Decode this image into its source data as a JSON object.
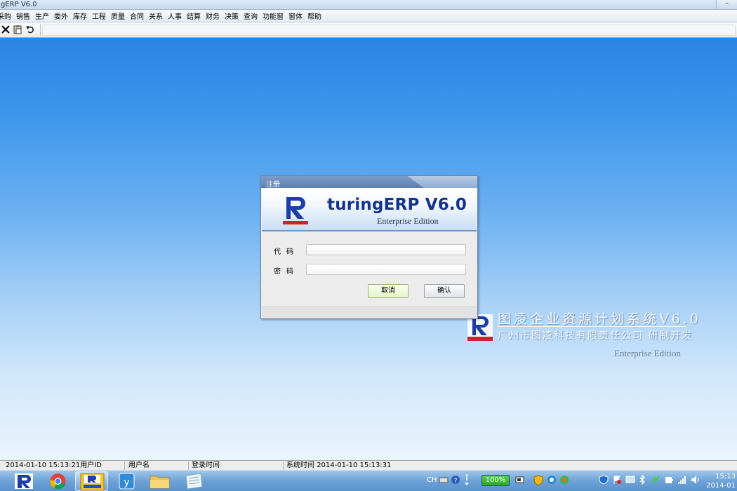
{
  "window": {
    "title": "gERP V6.0",
    "minimize_glyph": "–"
  },
  "menu": [
    "采购",
    "销售",
    "生产",
    "委外",
    "库存",
    "工程",
    "质量",
    "合同",
    "关系",
    "人事",
    "结算",
    "财务",
    "决策",
    "查询",
    "功能窗",
    "窗体",
    "帮助"
  ],
  "toolbar": {
    "icons": [
      "close-icon",
      "paste-icon",
      "undo-icon"
    ],
    "glyphs": [
      "✕",
      "📋",
      "↶"
    ]
  },
  "watermark": {
    "title": "图凌企业资源计划系统V6.0",
    "subtitle": "广州市图凌科技有限责任公司 研制开发",
    "edition": "Enterprise Edition"
  },
  "dialog": {
    "title": "注册",
    "product_name": "turingERP V6.0",
    "edition": "Enterprise Edition",
    "code_label": "代码",
    "password_label": "密码",
    "code_value": "",
    "password_value": "",
    "cancel_label": "取消",
    "ok_label": "确认"
  },
  "statusbar": {
    "datetime": "2014-01-10 15:13:21",
    "user_id_label": "用户ID",
    "user_name_label": "用户名",
    "login_time_label": "登录时间",
    "system_time_label": "系统时间",
    "system_time_value": "2014-01-10 15:13:31"
  },
  "taskbar": {
    "apps": [
      "turingerp-icon",
      "chrome-icon",
      "turingerp-window-icon",
      "yinxiang-icon",
      "file-explorer-icon",
      "notes-icon"
    ],
    "lang": "CH",
    "battery_label": "100%",
    "clock_time": "15:13",
    "clock_date": "2014-01"
  },
  "colors": {
    "brand_blue": "#13338c",
    "desktop_top": "#2a85e4",
    "desktop_bottom": "#eaf4fd",
    "logo_red": "#c8262d"
  }
}
